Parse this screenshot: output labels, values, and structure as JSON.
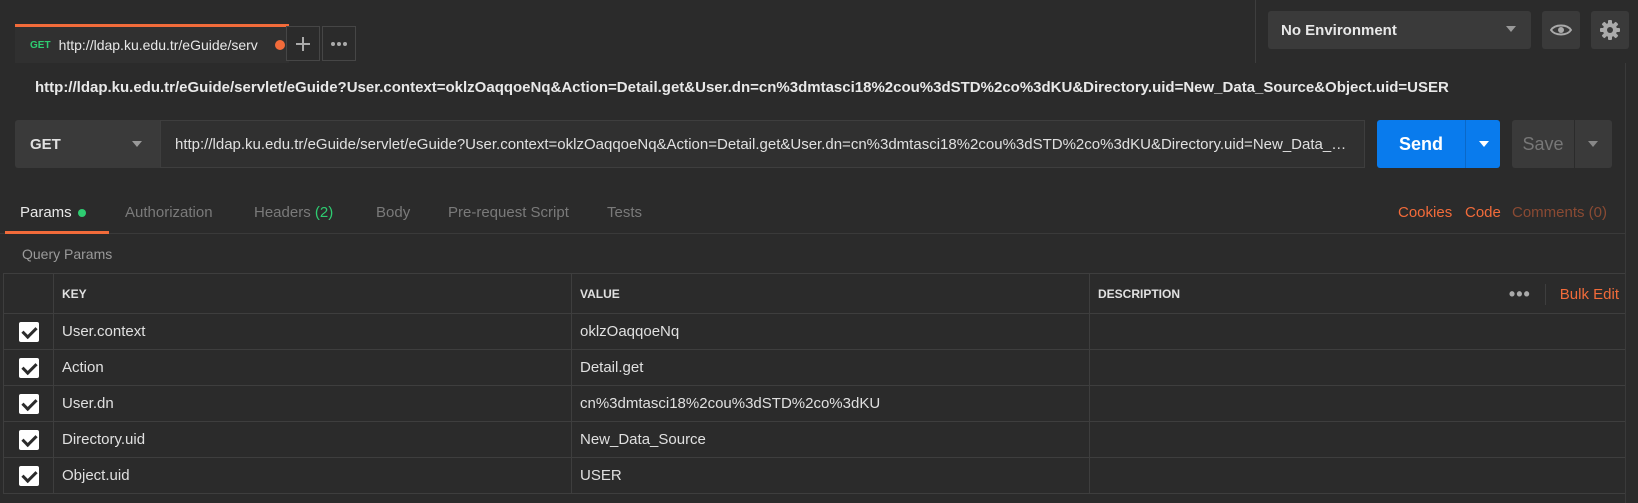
{
  "tab": {
    "method": "GET",
    "title": "http://ldap.ku.edu.tr/eGuide/serv",
    "new_tab_icon": "plus-icon",
    "more_icon": "ellipsis-icon"
  },
  "environment": {
    "selected": "No Environment",
    "eye_icon": "eye-icon",
    "settings_icon": "gear-icon"
  },
  "request": {
    "title": "http://ldap.ku.edu.tr/eGuide/servlet/eGuide?User.context=oklzOaqqoeNq&Action=Detail.get&User.dn=cn%3dmtasci18%2cou%3dSTD%2co%3dKU&Directory.uid=New_Data_Source&Object.uid=USER",
    "method": "GET",
    "url": "http://ldap.ku.edu.tr/eGuide/servlet/eGuide?User.context=oklzOaqqoeNq&Action=Detail.get&User.dn=cn%3dmtasci18%2cou%3dSTD%2co%3dKU&Directory.uid=New_Data_Source&Object.uid=USER",
    "send_label": "Send",
    "save_label": "Save"
  },
  "request_tabs": {
    "params": "Params",
    "authorization": "Authorization",
    "headers": "Headers",
    "headers_count": "(2)",
    "body": "Body",
    "pre_request": "Pre-request Script",
    "tests": "Tests",
    "cookies": "Cookies",
    "code": "Code",
    "comments": "Comments (0)"
  },
  "query_params": {
    "label": "Query Params",
    "columns": {
      "key": "KEY",
      "value": "VALUE",
      "description": "DESCRIPTION"
    },
    "more_icon": "ellipsis-icon",
    "bulk_edit": "Bulk Edit",
    "rows": [
      {
        "key": "User.context",
        "value": "oklzOaqqoeNq",
        "description": "",
        "checked": true
      },
      {
        "key": "Action",
        "value": "Detail.get",
        "description": "",
        "checked": true
      },
      {
        "key": "User.dn",
        "value": "cn%3dmtasci18%2cou%3dSTD%2co%3dKU",
        "description": "",
        "checked": true
      },
      {
        "key": "Directory.uid",
        "value": "New_Data_Source",
        "description": "",
        "checked": true
      },
      {
        "key": "Object.uid",
        "value": "USER",
        "description": "",
        "checked": true
      }
    ]
  },
  "colors": {
    "accent": "#f26b3a",
    "send": "#097bed",
    "method_get": "#2ecc71"
  }
}
